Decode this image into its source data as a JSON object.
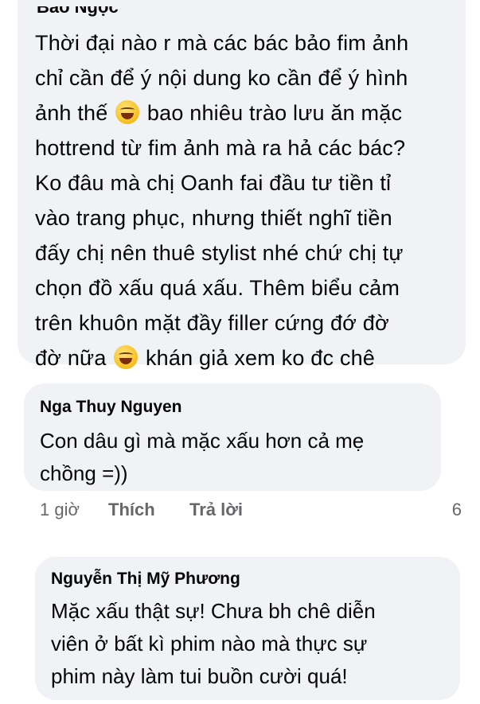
{
  "comments": [
    {
      "author_partial": "Bảo Ngọc",
      "lines": [
        "Thời đại nào r mà các bác bảo fim ảnh",
        "chỉ cần để ý nội dung ko cần để ý hình",
        "ảnh thế",
        "bao nhiêu trào lưu ăn mặc",
        "hottrend từ fim ảnh mà ra hả các bác?",
        "Ko đâu mà chị Oanh fai đầu tư tiền tỉ",
        "vào trang phục, nhưng thiết nghĩ tiền",
        "đấy chị nên thuê stylist nhé chứ chị tự",
        "chọn đồ xấu quá xấu. Thêm biểu cảm",
        "trên khuôn mặt đầy filler cứng đớ đờ",
        "đờ nữa",
        "khán giả xem ko đc chê"
      ],
      "emojis": [
        "rolling-on-floor-laughing-emoji",
        "face-with-tears-of-joy-emoji"
      ]
    },
    {
      "author": "Nga Thuy Nguyen",
      "lines": [
        "Con dâu gì mà mặc xấu hơn cả mẹ",
        "chồng =))"
      ],
      "actions": {
        "time": "1 giờ",
        "like": "Thích",
        "reply": "Trả lời",
        "count": "6"
      }
    },
    {
      "author": "Nguyễn Thị Mỹ Phương",
      "lines": [
        "Mặc xấu thật sự! Chưa bh chê diễn",
        "viên ở bất kì phim nào mà thực sự",
        "phim này làm tui buồn cười quá!"
      ]
    }
  ],
  "colors": {
    "bubble": "#f0f2f5",
    "text": "#050505",
    "meta": "#65676b"
  }
}
